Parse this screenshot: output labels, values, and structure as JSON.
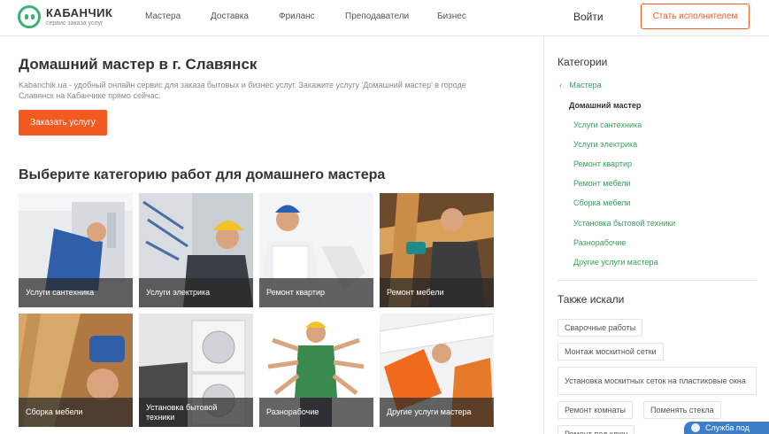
{
  "header": {
    "logo_name": "КАБАНЧИК",
    "logo_tagline": "сервис заказа услуг",
    "nav": [
      "Мастера",
      "Доставка",
      "Фриланс",
      "Преподаватели",
      "Бизнес"
    ],
    "login": "Войти",
    "become_executor": "Стать исполнителем"
  },
  "main": {
    "title": "Домашний мастер в г. Славянск",
    "description": "Kabanchik.ua - удобный онлайн сервис для заказа бытовых и бизнес услуг. Закажите услугу 'Домашний мастер' в городе Славянск на Кабанчике прямо сейчас.",
    "order_button": "Заказать услугу",
    "categories_title": "Выберите категорию работ для домашнего мастера",
    "tiles": [
      "Услуги сантехника",
      "Услуги электрика",
      "Ремонт квартир",
      "Ремонт мебели",
      "Сборка мебели",
      "Установка бытовой техники",
      "Разнорабочие",
      "Другие услуги мастера"
    ]
  },
  "sidebar": {
    "categories_title": "Категории",
    "back": "Мастера",
    "current": "Домашний мастер",
    "links": [
      "Услуги сантехника",
      "Услуги электрика",
      "Ремонт квартир",
      "Ремонт мебели",
      "Сборка мебели",
      "Установка бытовой техники",
      "Разнорабочие",
      "Другие услуги мастера"
    ],
    "also_title": "Также искали",
    "tags": [
      "Сварочные работы",
      "Монтаж москитной сетки",
      "Установка москитных сеток на пластиковые окна",
      "Ремонт комнаты",
      "Поменять стекла",
      "Ремонт под ключ"
    ]
  },
  "chat": {
    "label": "Служба под"
  },
  "colors": {
    "accent": "#f25a22",
    "brand_green": "#3bb273",
    "link_green": "#3a9e5d"
  }
}
